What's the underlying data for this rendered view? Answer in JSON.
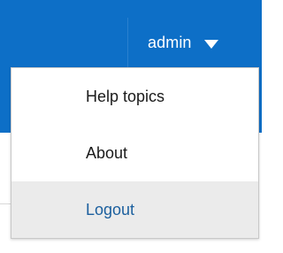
{
  "header": {
    "user_label": "admin",
    "accent_color": "#0d6fc7",
    "caret_icon": "caret-down-icon"
  },
  "menu": {
    "items": [
      {
        "label": "Help topics"
      },
      {
        "label": "About"
      },
      {
        "label": "Logout"
      }
    ],
    "highlight_color": "#ebebeb",
    "active_text_color": "#1b5f9e"
  }
}
